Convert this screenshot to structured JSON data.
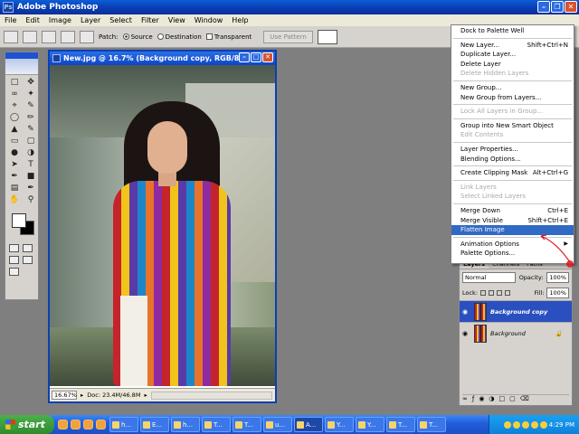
{
  "app": {
    "title": "Adobe Photoshop"
  },
  "menubar": [
    "File",
    "Edit",
    "Image",
    "Layer",
    "Select",
    "Filter",
    "View",
    "Window",
    "Help"
  ],
  "options": {
    "patch_label": "Patch:",
    "source_label": "Source",
    "destination_label": "Destination",
    "transparent_label": "Transparent",
    "use_pattern_label": "Use Pattern"
  },
  "document": {
    "title": "New.jpg @ 16.7% (Background copy, RGB/8)",
    "zoom": "16.67%",
    "doc_size": "Doc: 23.4M/46.8M"
  },
  "layers_panel": {
    "tabs": [
      "Layers",
      "Channels",
      "Paths"
    ],
    "blend_mode": "Normal",
    "opacity_label": "Opacity:",
    "opacity_value": "100%",
    "lock_label": "Lock:",
    "fill_label": "Fill:",
    "fill_value": "100%",
    "layers": [
      {
        "name": "Background copy",
        "selected": true
      },
      {
        "name": "Background",
        "selected": false
      }
    ]
  },
  "context_menu": {
    "items": [
      {
        "label": "Dock to Palette Well",
        "shortcut": "",
        "disabled": false,
        "group": 0
      },
      {
        "label": "New Layer...",
        "shortcut": "Shift+Ctrl+N",
        "disabled": false,
        "group": 1
      },
      {
        "label": "Duplicate Layer...",
        "shortcut": "",
        "disabled": false,
        "group": 1
      },
      {
        "label": "Delete Layer",
        "shortcut": "",
        "disabled": false,
        "group": 1
      },
      {
        "label": "Delete Hidden Layers",
        "shortcut": "",
        "disabled": true,
        "group": 1
      },
      {
        "label": "New Group...",
        "shortcut": "",
        "disabled": false,
        "group": 2
      },
      {
        "label": "New Group from Layers...",
        "shortcut": "",
        "disabled": false,
        "group": 2
      },
      {
        "label": "Lock All Layers in Group...",
        "shortcut": "",
        "disabled": true,
        "group": 3
      },
      {
        "label": "Group into New Smart Object",
        "shortcut": "",
        "disabled": false,
        "group": 4
      },
      {
        "label": "Edit Contents",
        "shortcut": "",
        "disabled": true,
        "group": 4
      },
      {
        "label": "Layer Properties...",
        "shortcut": "",
        "disabled": false,
        "group": 5
      },
      {
        "label": "Blending Options...",
        "shortcut": "",
        "disabled": false,
        "group": 5
      },
      {
        "label": "Create Clipping Mask",
        "shortcut": "Alt+Ctrl+G",
        "disabled": false,
        "group": 6
      },
      {
        "label": "Link Layers",
        "shortcut": "",
        "disabled": true,
        "group": 7
      },
      {
        "label": "Select Linked Layers",
        "shortcut": "",
        "disabled": true,
        "group": 7
      },
      {
        "label": "Merge Down",
        "shortcut": "Ctrl+E",
        "disabled": false,
        "group": 8
      },
      {
        "label": "Merge Visible",
        "shortcut": "Shift+Ctrl+E",
        "disabled": false,
        "group": 8
      },
      {
        "label": "Flatten Image",
        "shortcut": "",
        "disabled": false,
        "highlighted": true,
        "group": 8
      },
      {
        "label": "Animation Options",
        "shortcut": "",
        "disabled": false,
        "submenu": true,
        "group": 9
      },
      {
        "label": "Palette Options...",
        "shortcut": "",
        "disabled": false,
        "group": 9
      }
    ]
  },
  "taskbar": {
    "start_label": "start",
    "tasks": [
      "h...",
      "E...",
      "h...",
      "T...",
      "T...",
      "u...",
      "A...",
      "Y...",
      "Y...",
      "T...",
      "T..."
    ],
    "clock": "4:29 PM"
  },
  "colors": {
    "title_blue": "#0a3fb5",
    "menu_highlight": "#316ac5",
    "layer_selected": "#2a4fbf",
    "annotation_red": "#e0101a"
  }
}
